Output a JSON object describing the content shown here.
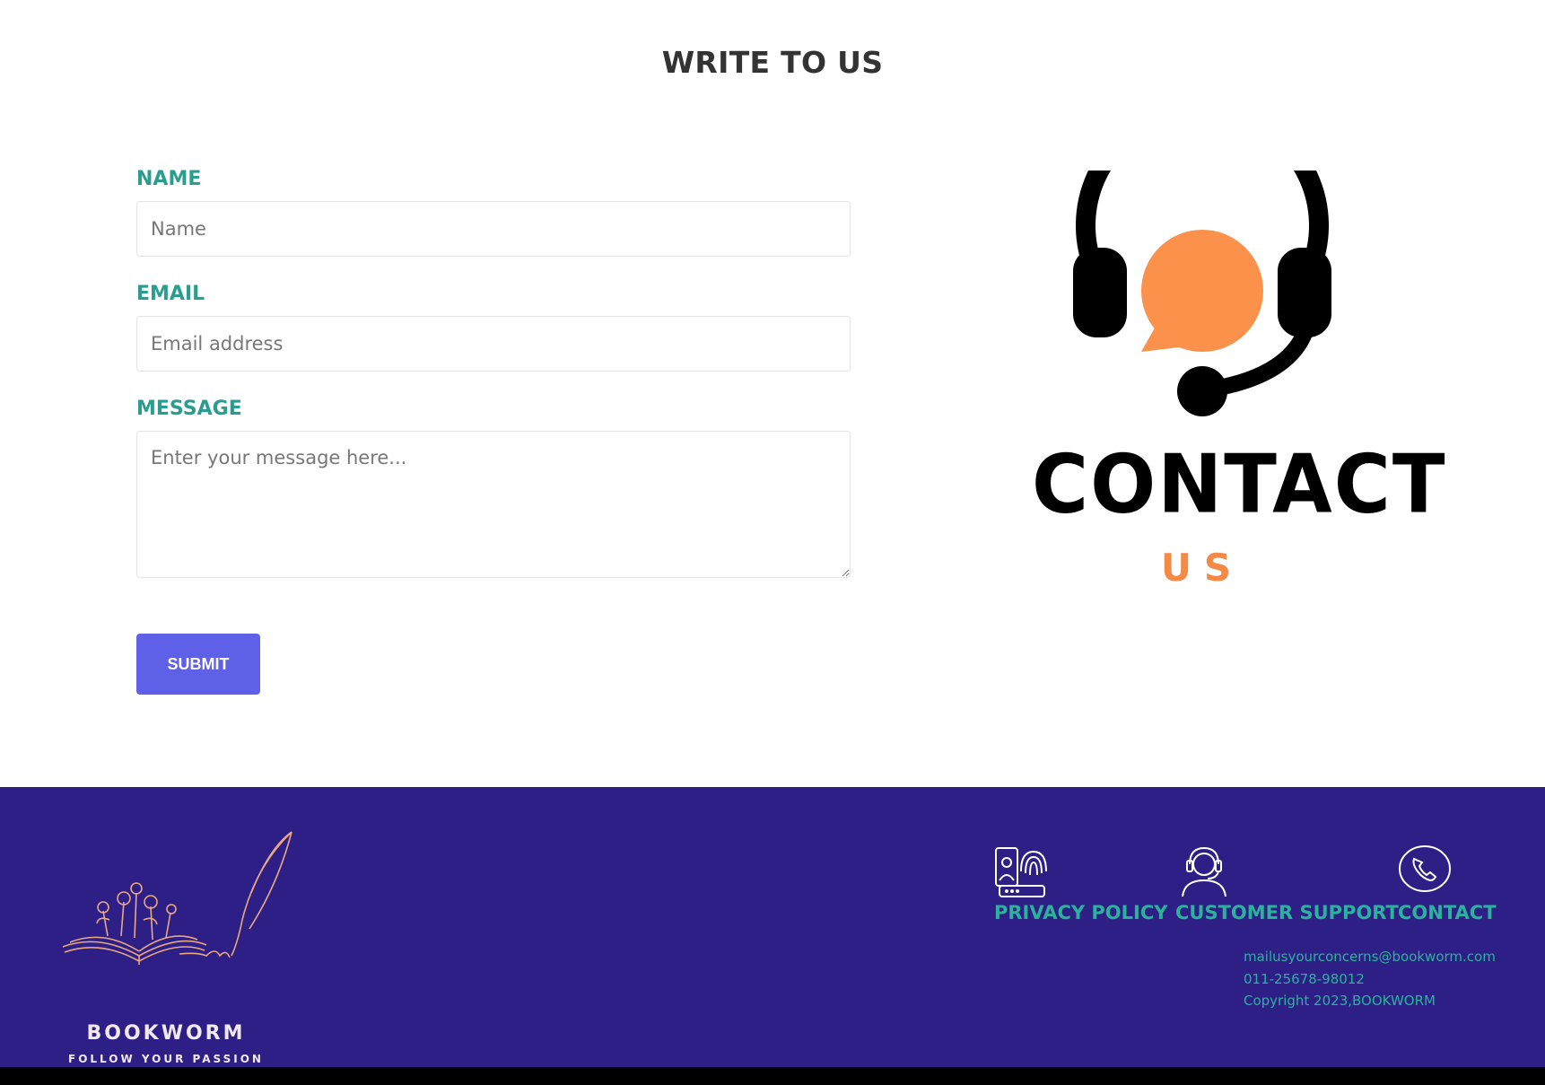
{
  "page": {
    "title": "WRITE TO US"
  },
  "form": {
    "name_label": "NAME",
    "name_placeholder": "Name",
    "email_label": "EMAIL",
    "email_placeholder": "Email address",
    "message_label": "MESSAGE",
    "message_placeholder": "Enter your message here...",
    "submit_label": "SUBMIT"
  },
  "illustration": {
    "word_main": "CONTACT",
    "word_sub": "US",
    "colors": {
      "headset": "#000000",
      "bubble": "#fb914b",
      "sub_text": "#f48a46"
    }
  },
  "footer": {
    "background": "#2e1f86",
    "link_color": "#2ab39b",
    "logo": {
      "name": "BOOKWORM",
      "tagline": "FOLLOW YOUR PASSION"
    },
    "links": [
      {
        "label": "PRIVACY POLICY",
        "icon": "fingerprint-id-icon"
      },
      {
        "label": "CUSTOMER SUPPORT",
        "icon": "support-agent-icon"
      },
      {
        "label": "CONTACT",
        "icon": "phone-icon"
      }
    ],
    "email": "mailusyourconcerns@bookworm.com",
    "phone": "011-25678-98012",
    "copyright": "Copyright 2023,BOOKWORM"
  }
}
